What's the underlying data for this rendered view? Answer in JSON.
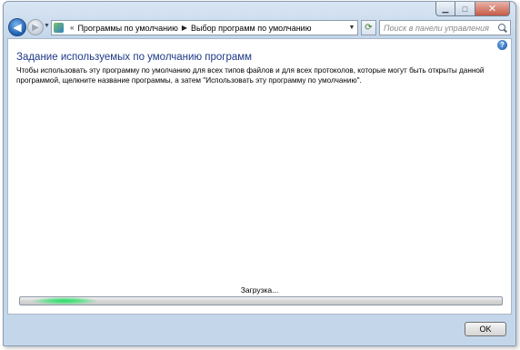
{
  "window": {
    "caption_buttons": {
      "minimize": "▁",
      "maximize": "□",
      "close": "✕"
    }
  },
  "nav": {
    "back_icon": "arrow-left-icon",
    "forward_icon": "arrow-right-icon",
    "breadcrumb_prefix": "«",
    "breadcrumb": [
      "Программы по умолчанию",
      "Выбор программ по умолчанию"
    ],
    "breadcrumb_separator": "▶",
    "search_placeholder": "Поиск в панели управления"
  },
  "content": {
    "title": "Задание используемых по умолчанию программ",
    "description": "Чтобы использовать эту программу по умолчанию для всех типов файлов и для всех протоколов, которые могут быть открыты данной программой, щелкните название программы, а затем \"Использовать эту программу по умолчанию\".",
    "loading_label": "Загрузка...",
    "help": "?"
  },
  "footer": {
    "ok_label": "OK"
  },
  "colors": {
    "title": "#1e3a87",
    "progress": "#2fd86a",
    "frame": "#c4d6ea"
  }
}
